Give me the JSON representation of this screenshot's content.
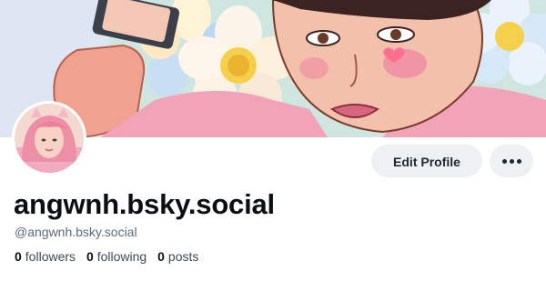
{
  "profile": {
    "display_name": "angwnh.bsky.social",
    "handle": "@angwnh.bsky.social",
    "edit_profile_label": "Edit Profile",
    "more_icon": "more-horizontal-icon"
  },
  "stats": {
    "followers_count": "0",
    "followers_label": "followers",
    "following_count": "0",
    "following_label": "following",
    "posts_count": "0",
    "posts_label": "posts"
  },
  "colors": {
    "button_bg": "#eef1f4",
    "handle_text": "#5b6b7c",
    "name_text": "#0b0f14"
  }
}
